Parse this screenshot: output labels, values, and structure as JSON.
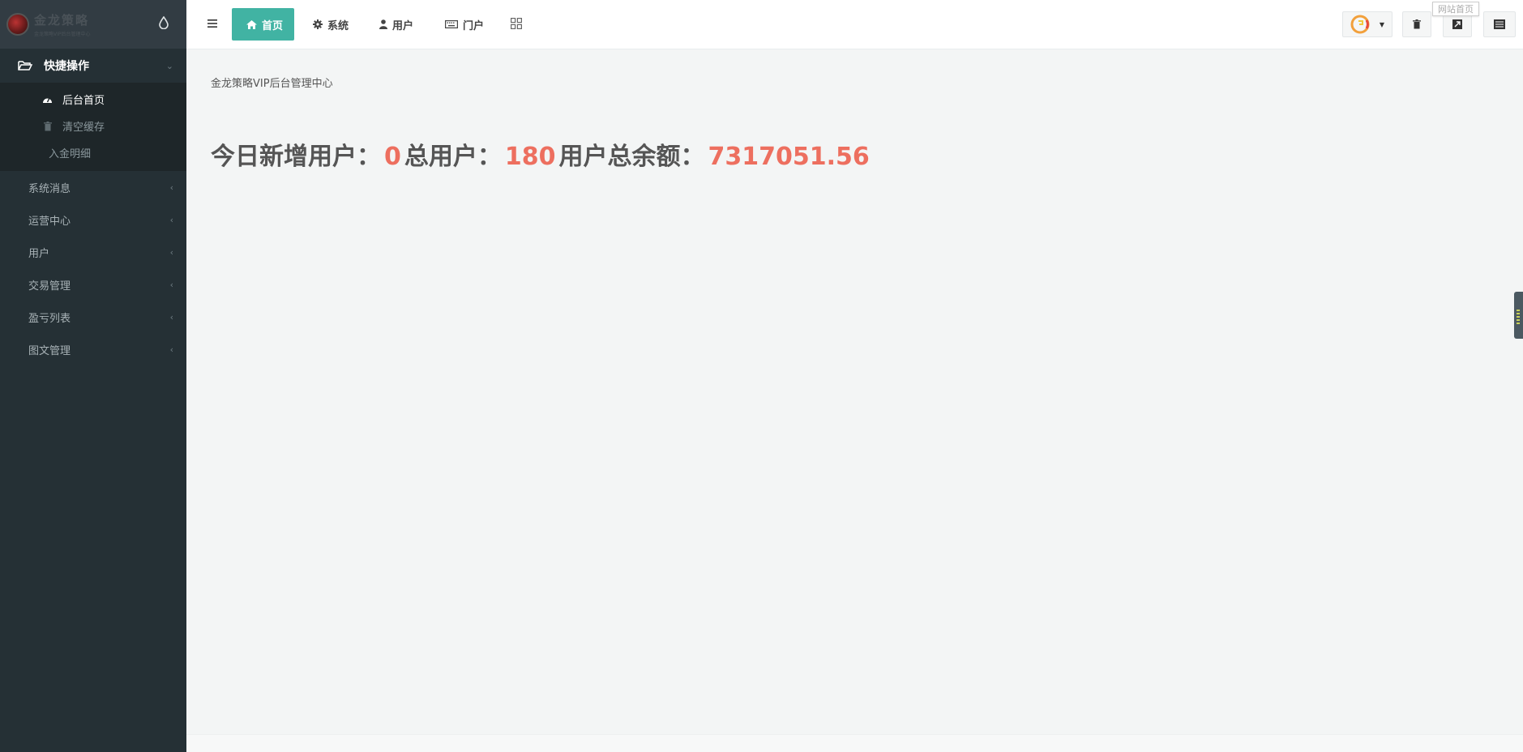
{
  "brand": {
    "title": "金龙策略",
    "subtitle": "金龙策略VIP后台管理中心"
  },
  "sidebar": {
    "group": {
      "label": "快捷操作"
    },
    "sub_items": [
      {
        "label": "后台首页",
        "active": true,
        "icon": "dashboard-icon"
      },
      {
        "label": "清空缓存",
        "active": false,
        "icon": "trash-icon"
      },
      {
        "label": "入金明细",
        "active": false,
        "icon": ""
      }
    ],
    "items": [
      {
        "label": "系统消息"
      },
      {
        "label": "运营中心"
      },
      {
        "label": "用户"
      },
      {
        "label": "交易管理"
      },
      {
        "label": "盈亏列表"
      },
      {
        "label": "图文管理"
      }
    ]
  },
  "topbar": {
    "tabs": [
      {
        "label": "首页",
        "icon": "home-icon",
        "active": true
      },
      {
        "label": "系统",
        "icon": "gear-icon",
        "active": false
      },
      {
        "label": "用户",
        "icon": "user-icon",
        "active": false
      },
      {
        "label": "门户",
        "icon": "keyboard-icon",
        "active": false
      }
    ],
    "tooltip": "网站首页"
  },
  "content": {
    "breadcrumb": "金龙策略VIP后台管理中心",
    "stats": {
      "new_users_label": "今日新增用户：",
      "new_users_value": "0",
      "total_users_label": "总用户：",
      "total_users_value": "180",
      "total_balance_label": "用户总余额：",
      "total_balance_value": "7317051.56"
    }
  },
  "colors": {
    "accent": "#41b3a3",
    "highlight_number": "#ed6f5f",
    "sidebar_bg": "#253035"
  }
}
